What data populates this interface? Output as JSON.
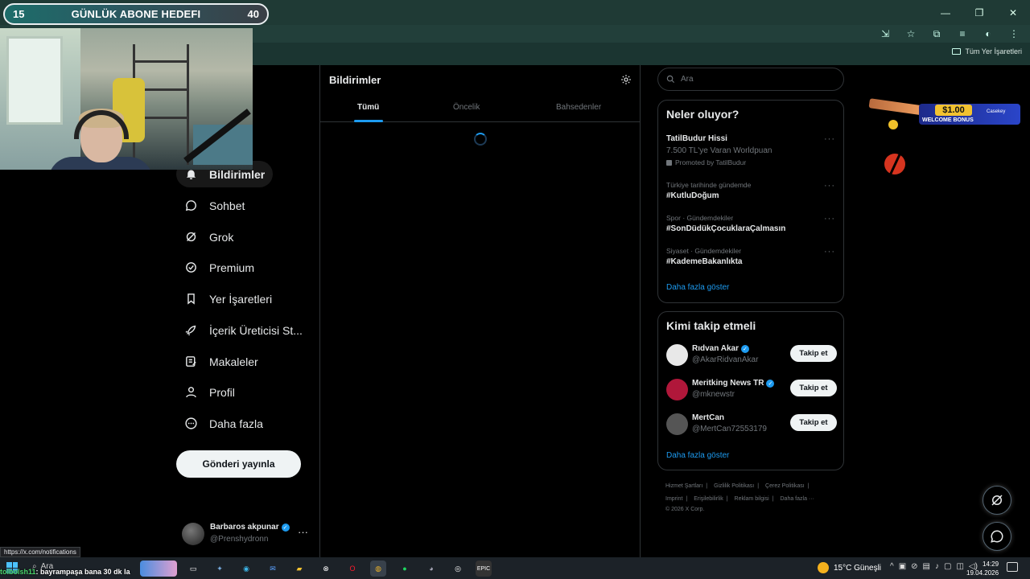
{
  "browser": {
    "bookmarks_all": "Tüm Yer İşaretleri",
    "status_url": "https://x.com/notifications"
  },
  "overlay": {
    "goal_current": "15",
    "goal_label": "GÜNLÜK ABONE HEDEFI",
    "goal_target": "40",
    "chat_user": "tolbolsh11",
    "chat_text": ": bayrampaşa bana 30 dk la"
  },
  "nav": {
    "items": [
      {
        "label": "Bildirimler",
        "icon": "bell-icon",
        "active": true
      },
      {
        "label": "Sohbet",
        "icon": "chat-icon"
      },
      {
        "label": "Grok",
        "icon": "grok-icon"
      },
      {
        "label": "Premium",
        "icon": "premium-icon"
      },
      {
        "label": "Yer İşaretleri",
        "icon": "bookmark-icon"
      },
      {
        "label": "İçerik Üreticisi St...",
        "icon": "rocket-icon"
      },
      {
        "label": "Makaleler",
        "icon": "article-icon"
      },
      {
        "label": "Profil",
        "icon": "profile-icon"
      },
      {
        "label": "Daha fazla",
        "icon": "more-circle-icon"
      }
    ],
    "post_button": "Gönderi yayınla",
    "account": {
      "name": "Barbaros akpunar",
      "handle": "@Prenshydronn"
    }
  },
  "main": {
    "title": "Bildirimler",
    "tabs": [
      "Tümü",
      "Öncelik",
      "Bahsedenler"
    ],
    "active_tab": 0
  },
  "right": {
    "search_placeholder": "Ara",
    "trends_title": "Neler oluyor?",
    "promoted": {
      "name": "TatilBudur Hissi",
      "sub": "7.500 TL'ye Varan Worldpuan",
      "promo": "Promoted by TatilBudur"
    },
    "trends": [
      {
        "meta": "Türkiye tarihinde gündemde",
        "name": "#KutluDoğum"
      },
      {
        "meta": "Spor · Gündemdekiler",
        "name": "#SonDüdükÇocuklaraÇalmasın"
      },
      {
        "meta": "Siyaset · Gündemdekiler",
        "name": "#KademeBakanlıkta"
      }
    ],
    "trends_more": "Daha fazla göster",
    "follow_title": "Kimi takip etmeli",
    "follow": [
      {
        "name": "Rıdvan Akar",
        "handle": "@AkarRidvanAkar",
        "color": "#e8e8e8",
        "verified": true
      },
      {
        "name": "Meritking News TR",
        "handle": "@mknewstr",
        "color": "#b0173a",
        "verified": true
      },
      {
        "name": "MertCan",
        "handle": "@MertCan72553179",
        "color": "#555555",
        "verified": false
      }
    ],
    "follow_button": "Takip et",
    "follow_more": "Daha fazla göster",
    "footer": [
      "Hizmet Şartları",
      "Gizlilik Politikası",
      "Çerez Politikası",
      "Imprint",
      "Erişilebilirlik",
      "Reklam bilgisi",
      "Daha fazla ···",
      "© 2026 X Corp."
    ]
  },
  "ad": {
    "price": "$1.00",
    "bonus": "WELCOME BONUS",
    "brand": "Casekey"
  },
  "taskbar": {
    "search": "Ara",
    "weather": "15°C  Güneşli",
    "time": "14:29",
    "date": "19.04.2026"
  },
  "colors": {
    "accent": "#1d9bf0",
    "background": "#000000",
    "border": "#2f3336"
  }
}
